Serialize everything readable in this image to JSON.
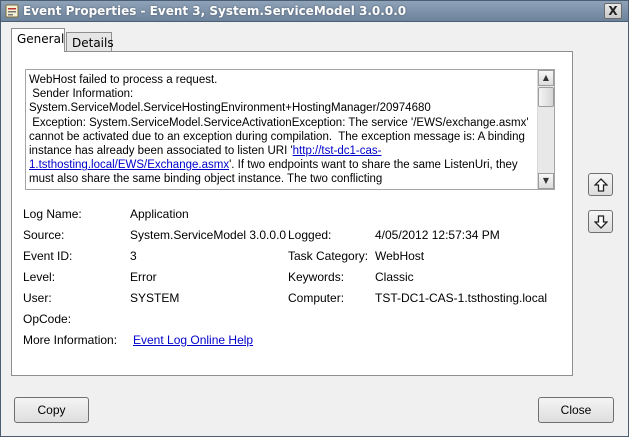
{
  "window": {
    "title": "Event Properties - Event 3, System.ServiceModel 3.0.0.0",
    "close_glyph": "X"
  },
  "tabs": [
    {
      "label": "General",
      "active": true
    },
    {
      "label": "Details",
      "active": false
    }
  ],
  "description": {
    "text_before_link": "WebHost failed to process a request.\n Sender Information: System.ServiceModel.ServiceHostingEnvironment+HostingManager/20974680\n Exception: System.ServiceModel.ServiceActivationException: The service '/EWS/exchange.asmx' cannot be activated due to an exception during compilation.  The exception message is: A binding instance has already been associated to listen URI '",
    "link_text": "http://tst-dc1-cas-1.tsthosting.local/EWS/Exchange.asmx",
    "text_after_link": "'. If two endpoints want to share the same ListenUri, they must also share the same binding object instance. The two conflicting"
  },
  "fields": {
    "log_name": {
      "label": "Log Name:",
      "value": "Application"
    },
    "source": {
      "label": "Source:",
      "value": "System.ServiceModel 3.0.0.0"
    },
    "logged": {
      "label": "Logged:",
      "value": "4/05/2012 12:57:34 PM"
    },
    "event_id": {
      "label": "Event ID:",
      "value": "3"
    },
    "task_category": {
      "label": "Task Category:",
      "value": "WebHost"
    },
    "level": {
      "label": "Level:",
      "value": "Error"
    },
    "keywords": {
      "label": "Keywords:",
      "value": "Classic"
    },
    "user": {
      "label": "User:",
      "value": "SYSTEM"
    },
    "computer": {
      "label": "Computer:",
      "value": "TST-DC1-CAS-1.tsthosting.local"
    },
    "opcode": {
      "label": "OpCode:",
      "value": ""
    },
    "more_info": {
      "label": "More Information:",
      "link": "Event Log Online Help"
    }
  },
  "buttons": {
    "copy": "Copy",
    "close": "Close"
  },
  "icons": {
    "title": "event-viewer-icon",
    "previous": "arrow-up-icon",
    "next": "arrow-down-icon"
  }
}
